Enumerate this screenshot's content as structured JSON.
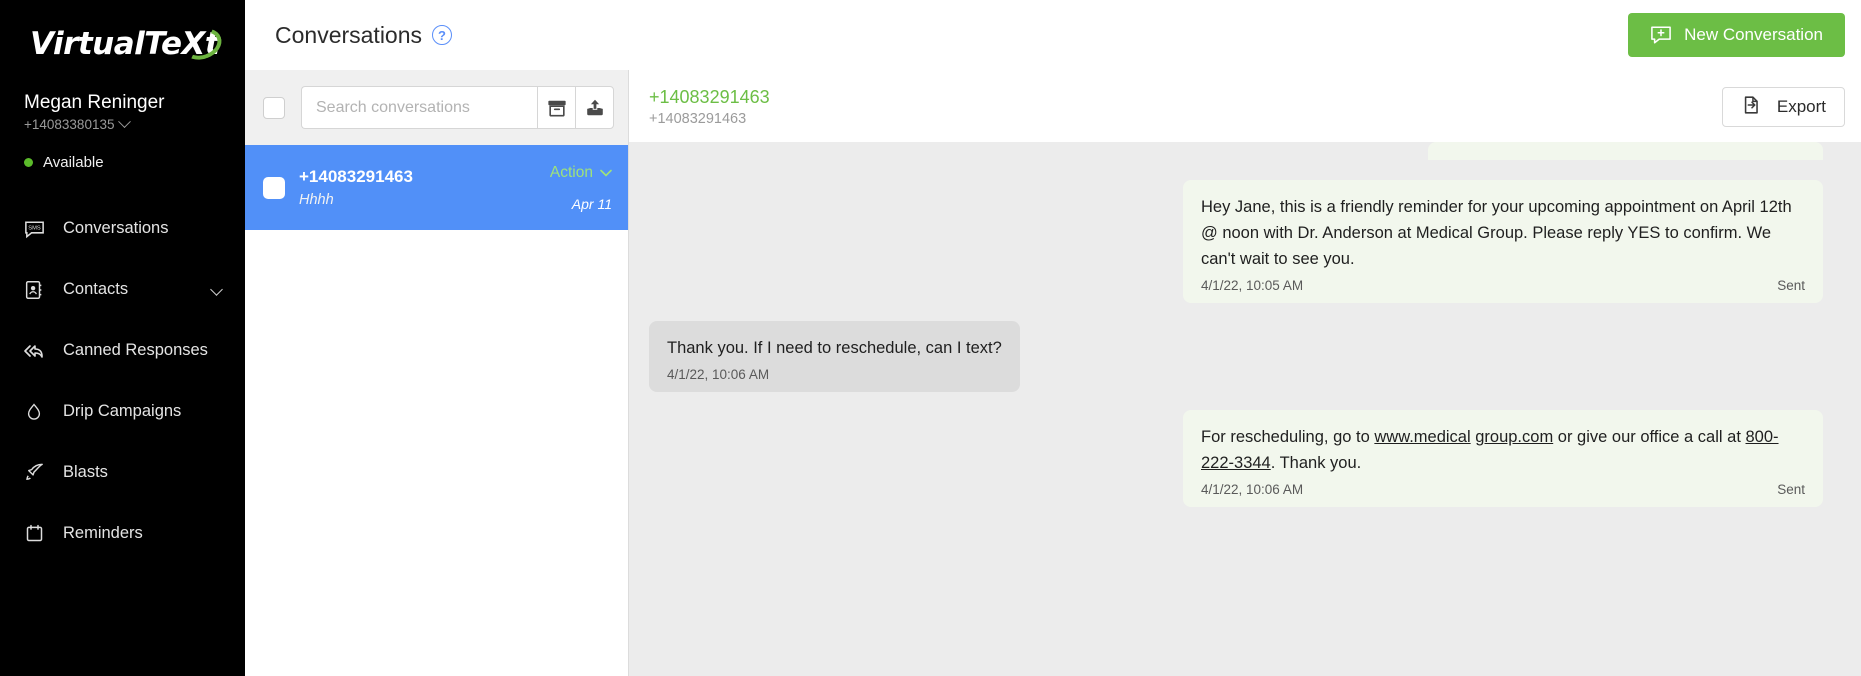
{
  "sidebar": {
    "logo_text_1": "VirtualTe",
    "logo_text_x": "X",
    "logo_text_2": "t",
    "user_name": "Megan Reninger",
    "user_phone": "+14083380135",
    "status": "Available",
    "items": [
      {
        "label": "Conversations",
        "icon": "sms-bubble-icon",
        "has_chevron": false
      },
      {
        "label": "Contacts",
        "icon": "address-book-icon",
        "has_chevron": true
      },
      {
        "label": "Canned Responses",
        "icon": "reply-all-icon",
        "has_chevron": false
      },
      {
        "label": "Drip Campaigns",
        "icon": "water-drop-icon",
        "has_chevron": false
      },
      {
        "label": "Blasts",
        "icon": "rocket-icon",
        "has_chevron": false
      },
      {
        "label": "Reminders",
        "icon": "calendar-icon",
        "has_chevron": false
      }
    ]
  },
  "header": {
    "title": "Conversations",
    "help_glyph": "?",
    "new_conversation_label": "New Conversation"
  },
  "conversation_list": {
    "search_placeholder": "Search conversations",
    "search_value": "",
    "archive_icon": "archive-box-icon",
    "upload_icon": "upload-icon",
    "items": [
      {
        "name": "+14083291463",
        "preview": "Hhhh",
        "action_label": "Action",
        "date": "Apr 11",
        "selected": true
      }
    ]
  },
  "thread": {
    "title": "+14083291463",
    "subtitle": "+14083291463",
    "export_label": "Export",
    "messages": [
      {
        "direction": "out",
        "text": "Hey Jane, this is a friendly reminder for your upcoming appointment on April 12th @ noon with Dr. Anderson at Medical Group. Please reply YES to confirm. We can't wait to see you.",
        "time": "4/1/22, 10:05 AM",
        "status": "Sent"
      },
      {
        "direction": "in",
        "text": "Thank you. If I need to reschedule, can I text?",
        "time": "4/1/22, 10:06 AM",
        "status": ""
      },
      {
        "direction": "out",
        "text_parts": [
          {
            "t": "For rescheduling, go to ",
            "link": false
          },
          {
            "t": "www.medical",
            "link": true
          },
          {
            "t": " ",
            "link": false
          },
          {
            "t": "group.com",
            "link": true
          },
          {
            "t": " or give our office a call at ",
            "link": false
          },
          {
            "t": "800-222-3344",
            "link": true
          },
          {
            "t": ". Thank you.",
            "link": false
          }
        ],
        "time": "4/1/22, 10:06 AM",
        "status": "Sent"
      }
    ]
  },
  "colors": {
    "brand_green": "#6cbe45",
    "selected_blue": "#5190f8",
    "sidebar_bg": "#000000",
    "thread_bg": "#ececec",
    "out_bubble": "#f2f7ed",
    "in_bubble": "#dcdcdc"
  }
}
